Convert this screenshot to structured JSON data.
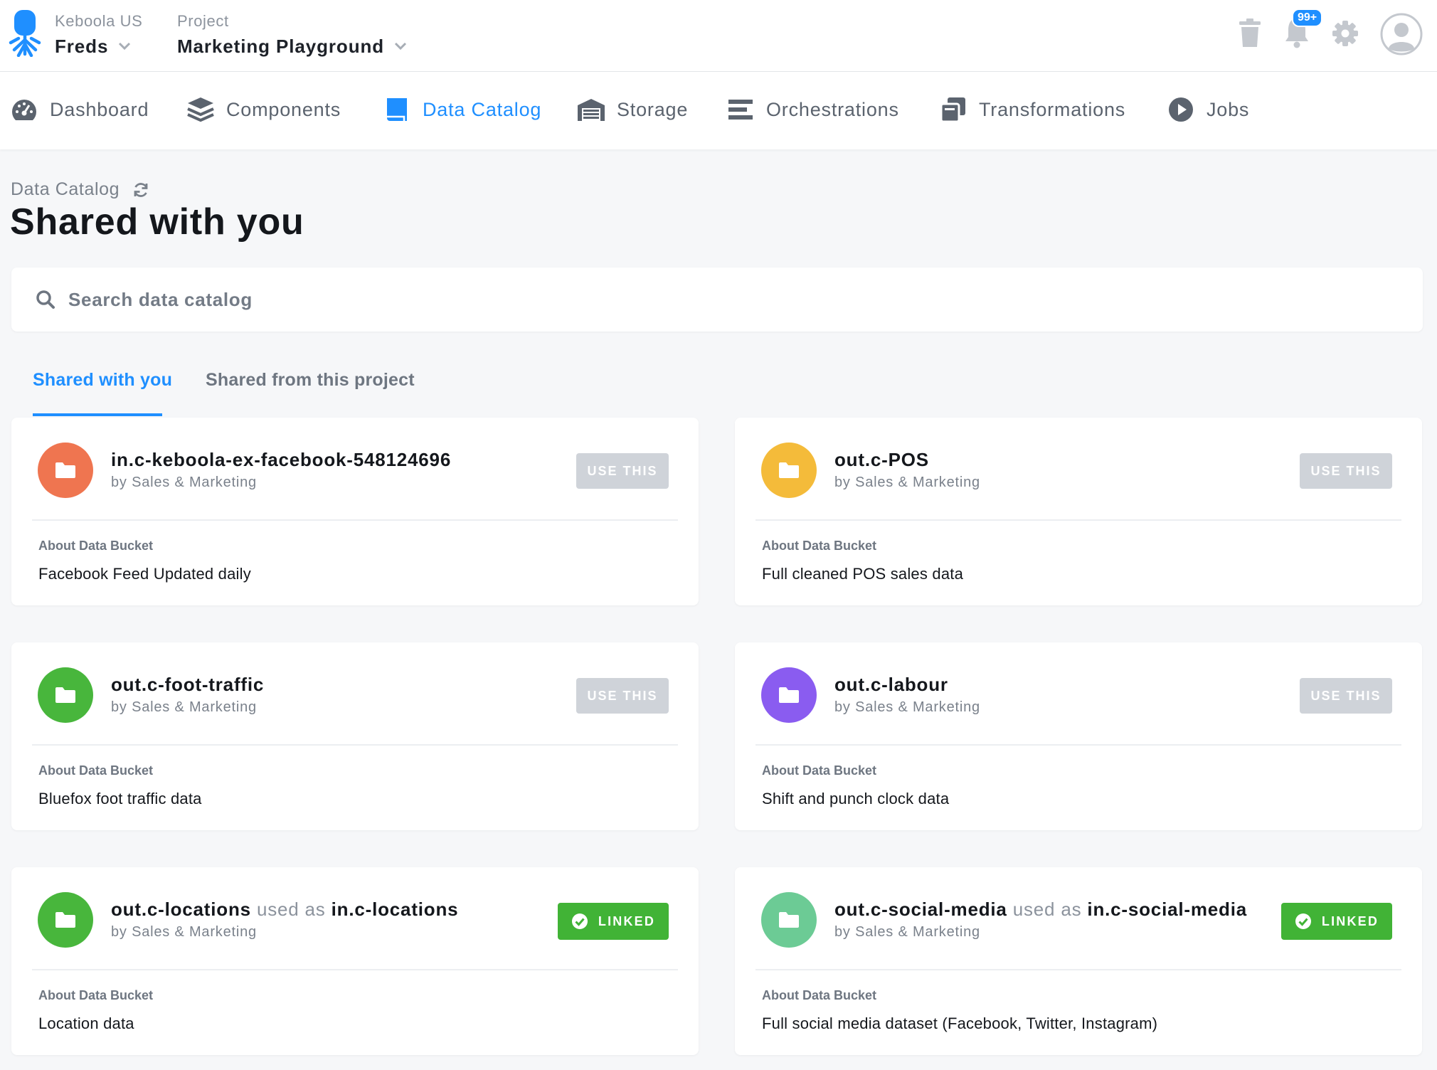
{
  "header": {
    "org_label": "Keboola US",
    "org_value": "Freds",
    "project_label": "Project",
    "project_value": "Marketing Playground",
    "notifications_badge": "99+"
  },
  "nav": {
    "items": [
      {
        "label": "Dashboard",
        "icon": "dashboard-icon",
        "active": false
      },
      {
        "label": "Components",
        "icon": "layers-icon",
        "active": false
      },
      {
        "label": "Data Catalog",
        "icon": "book-icon",
        "active": true
      },
      {
        "label": "Storage",
        "icon": "warehouse-icon",
        "active": false
      },
      {
        "label": "Orchestrations",
        "icon": "bars-icon",
        "active": false
      },
      {
        "label": "Transformations",
        "icon": "copy-icon",
        "active": false
      },
      {
        "label": "Jobs",
        "icon": "play-circle-icon",
        "active": false
      }
    ]
  },
  "page": {
    "pre_title": "Data Catalog",
    "title": "Shared with you"
  },
  "search": {
    "placeholder": "Search data catalog"
  },
  "tabs": [
    {
      "label": "Shared with you",
      "active": true
    },
    {
      "label": "Shared from this project",
      "active": false
    }
  ],
  "cards": [
    {
      "name": "in.c-keboola-ex-facebook-548124696",
      "used_as_text": "",
      "used_as": "",
      "owner": "by Sales & Marketing",
      "button": "USE THIS",
      "linked": false,
      "about_label": "About Data Bucket",
      "about": "Facebook Feed Updated daily",
      "color": "#ef7550"
    },
    {
      "name": "out.c-POS",
      "used_as_text": "",
      "used_as": "",
      "owner": "by Sales & Marketing",
      "button": "USE THIS",
      "linked": false,
      "about_label": "About Data Bucket",
      "about": "Full cleaned POS sales data",
      "color": "#f4bb3a"
    },
    {
      "name": "out.c-foot-traffic",
      "used_as_text": "",
      "used_as": "",
      "owner": "by Sales & Marketing",
      "button": "USE THIS",
      "linked": false,
      "about_label": "About Data Bucket",
      "about": "Bluefox foot traffic data",
      "color": "#48b63c"
    },
    {
      "name": "out.c-labour",
      "used_as_text": "",
      "used_as": "",
      "owner": "by Sales & Marketing",
      "button": "USE THIS",
      "linked": false,
      "about_label": "About Data Bucket",
      "about": "Shift and punch clock data",
      "color": "#8a5cf0"
    },
    {
      "name": "out.c-locations",
      "used_as_text": "used as",
      "used_as": "in.c-locations",
      "owner": "by Sales & Marketing",
      "button": "LINKED",
      "linked": true,
      "about_label": "About Data Bucket",
      "about": "Location data",
      "color": "#48b63c"
    },
    {
      "name": "out.c-social-media",
      "used_as_text": "used as",
      "used_as": "in.c-social-media",
      "owner": "by Sales & Marketing",
      "button": "LINKED",
      "linked": true,
      "about_label": "About Data Bucket",
      "about": "Full social media dataset (Facebook, Twitter, Instagram)",
      "color": "#6ccb95"
    }
  ],
  "colors": {
    "accent": "#1f8fff",
    "linked": "#41b336",
    "button_disabled": "#cfd3d9"
  }
}
